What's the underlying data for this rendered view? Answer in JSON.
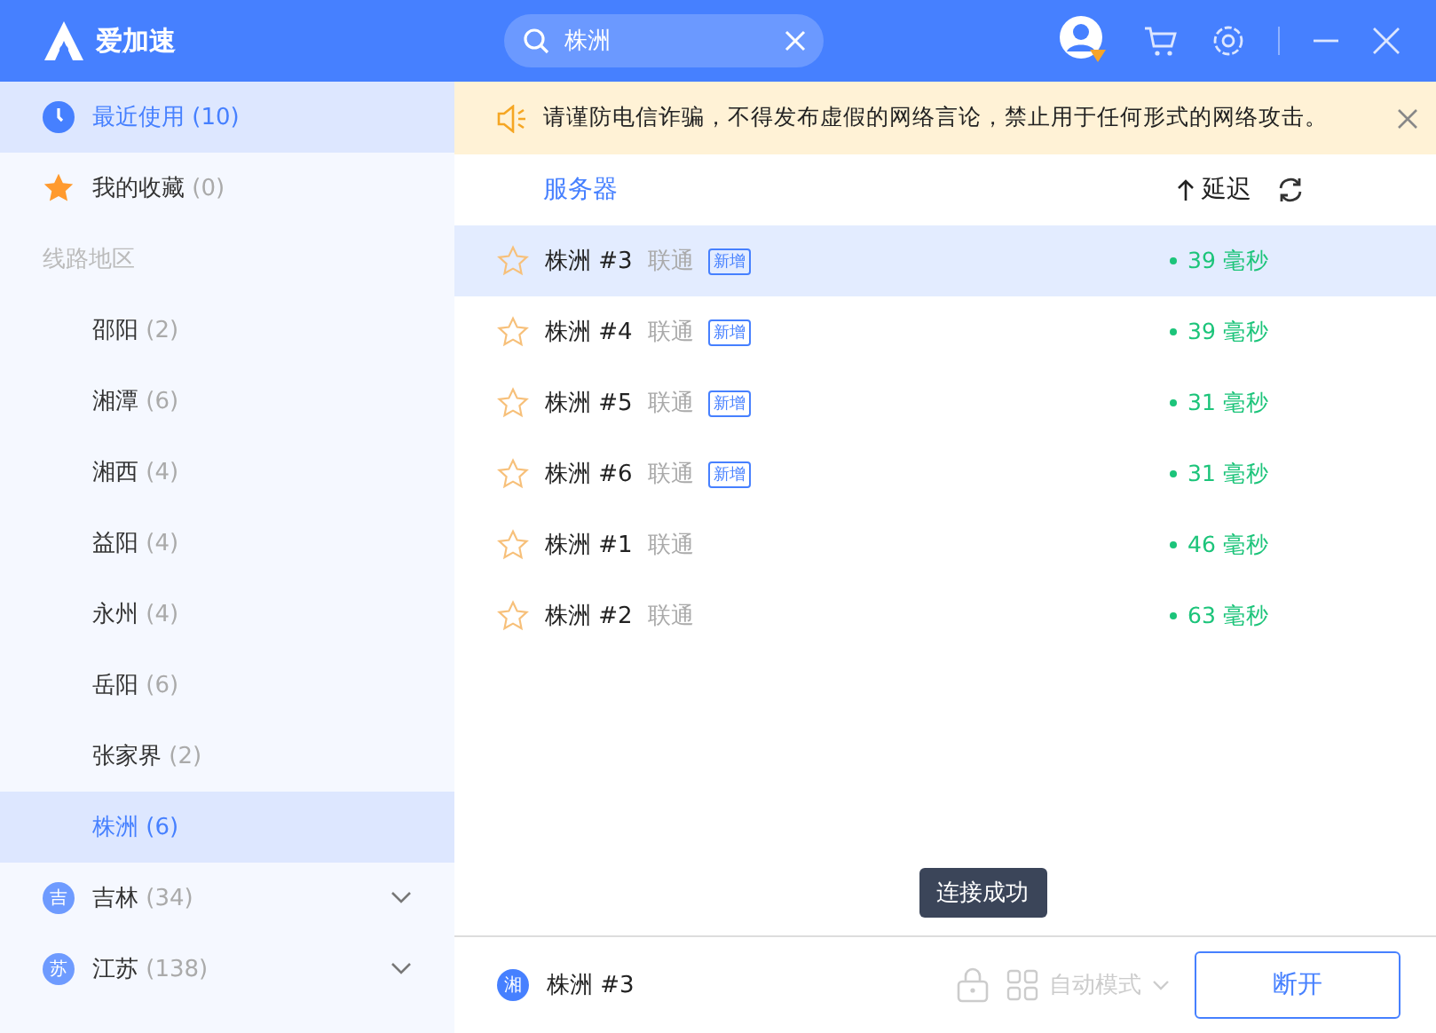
{
  "app": {
    "name": "爱加速"
  },
  "search": {
    "value": "株洲"
  },
  "sidebar": {
    "top_items": [
      {
        "kind": "recent",
        "label": "最近使用",
        "count": "(10)",
        "selected": true
      },
      {
        "kind": "favorites",
        "label": "我的收藏",
        "count": "(0)",
        "selected": false
      }
    ],
    "section_title": "线路地区",
    "regions": [
      {
        "label": "邵阳",
        "count": "(2)",
        "selected": false
      },
      {
        "label": "湘潭",
        "count": "(6)",
        "selected": false
      },
      {
        "label": "湘西",
        "count": "(4)",
        "selected": false
      },
      {
        "label": "益阳",
        "count": "(4)",
        "selected": false
      },
      {
        "label": "永州",
        "count": "(4)",
        "selected": false
      },
      {
        "label": "岳阳",
        "count": "(6)",
        "selected": false
      },
      {
        "label": "张家界",
        "count": "(2)",
        "selected": false
      },
      {
        "label": "株洲",
        "count": "(6)",
        "selected": true
      }
    ],
    "provinces": [
      {
        "badge": "吉",
        "label": "吉林",
        "count": "(34)",
        "expanded": false
      },
      {
        "badge": "苏",
        "label": "江苏",
        "count": "(138)",
        "expanded": false
      }
    ]
  },
  "notice": {
    "text": "请谨防电信诈骗，不得发布虚假的网络言论，禁止用于任何形式的网络攻击。"
  },
  "table": {
    "columns": [
      "服务器",
      "延迟"
    ],
    "rows": [
      {
        "name": "株洲 #3",
        "isp": "联通",
        "tag": "新增",
        "latency": "39 毫秒",
        "selected": true
      },
      {
        "name": "株洲 #4",
        "isp": "联通",
        "tag": "新增",
        "latency": "39 毫秒",
        "selected": false
      },
      {
        "name": "株洲 #5",
        "isp": "联通",
        "tag": "新增",
        "latency": "31 毫秒",
        "selected": false
      },
      {
        "name": "株洲 #6",
        "isp": "联通",
        "tag": "新增",
        "latency": "31 毫秒",
        "selected": false
      },
      {
        "name": "株洲 #1",
        "isp": "联通",
        "latency": "46 毫秒",
        "selected": false
      },
      {
        "name": "株洲 #2",
        "isp": "联通",
        "latency": "63 毫秒",
        "selected": false
      }
    ]
  },
  "toast": "连接成功",
  "footer": {
    "badge": "湘",
    "server": "株洲 #3",
    "mode": "自动模式",
    "button": "断开"
  }
}
